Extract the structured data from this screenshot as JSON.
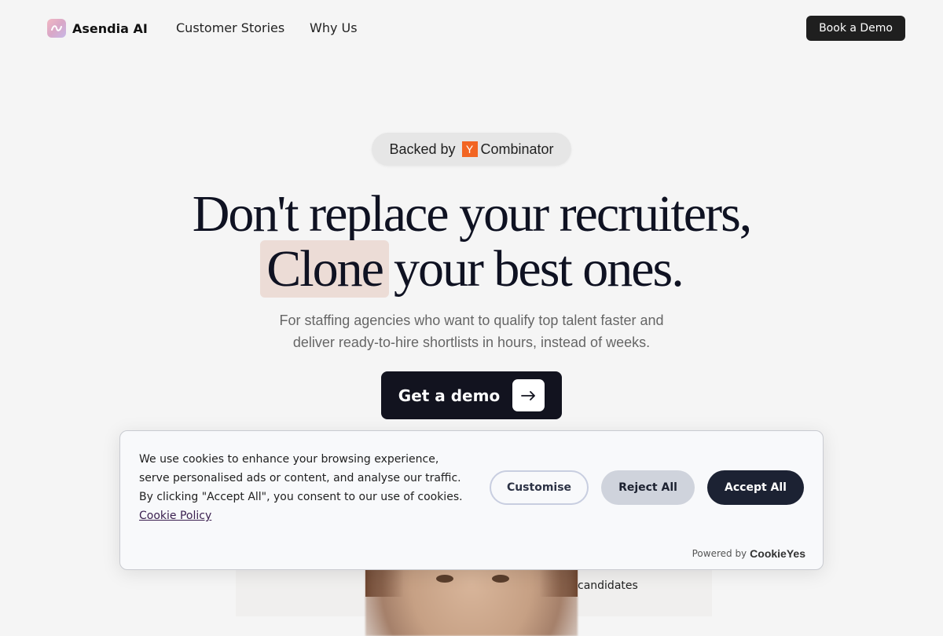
{
  "nav": {
    "brand": "Asendia AI",
    "links": [
      "Customer Stories",
      "Why Us"
    ],
    "cta": "Book a Demo"
  },
  "hero": {
    "badge_prefix": "Backed by",
    "badge_logo_letter": "Y",
    "badge_suffix": "Combinator",
    "headline_line1": "Don't replace your recruiters,",
    "headline_highlight": "Clone",
    "headline_line2_rest": "your best ones.",
    "subtitle_line1": "For staffing agencies who want to qualify top talent faster and",
    "subtitle_line2": "deliver ready-to-hire shortlists in hours, instead of weeks.",
    "cta": "Get a demo"
  },
  "background": {
    "partial_text": "candidates"
  },
  "cookie_banner": {
    "text": "We use cookies to enhance your browsing experience, serve personalised ads or content, and analyse our traffic. By clicking \"Accept All\", you consent to our use of cookies.",
    "link": "Cookie Policy",
    "buttons": {
      "customise": "Customise",
      "reject": "Reject All",
      "accept": "Accept All"
    },
    "powered_by": "Powered by",
    "powered_brand": "CookieYes"
  },
  "colors": {
    "accent_dark": "#12131f",
    "yc_orange": "#f26522",
    "highlight": "#ecdcd6"
  }
}
